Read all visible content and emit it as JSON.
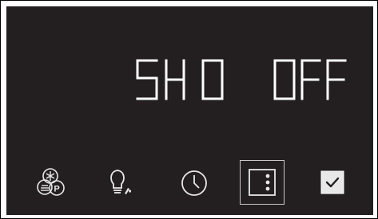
{
  "display": {
    "main_text": "SH 0",
    "status_text": "OFF"
  },
  "controls": [
    {
      "id": "spa",
      "icon": "spa-pump-icon"
    },
    {
      "id": "light",
      "icon": "light-bulb-icon"
    },
    {
      "id": "timer",
      "icon": "clock-icon"
    },
    {
      "id": "menu",
      "icon": "menu-icon"
    },
    {
      "id": "confirm",
      "icon": "checkmark-icon"
    }
  ],
  "colors": {
    "panel": "#231f20",
    "segment": "#ffffff",
    "icon": "#e8e8e8"
  }
}
